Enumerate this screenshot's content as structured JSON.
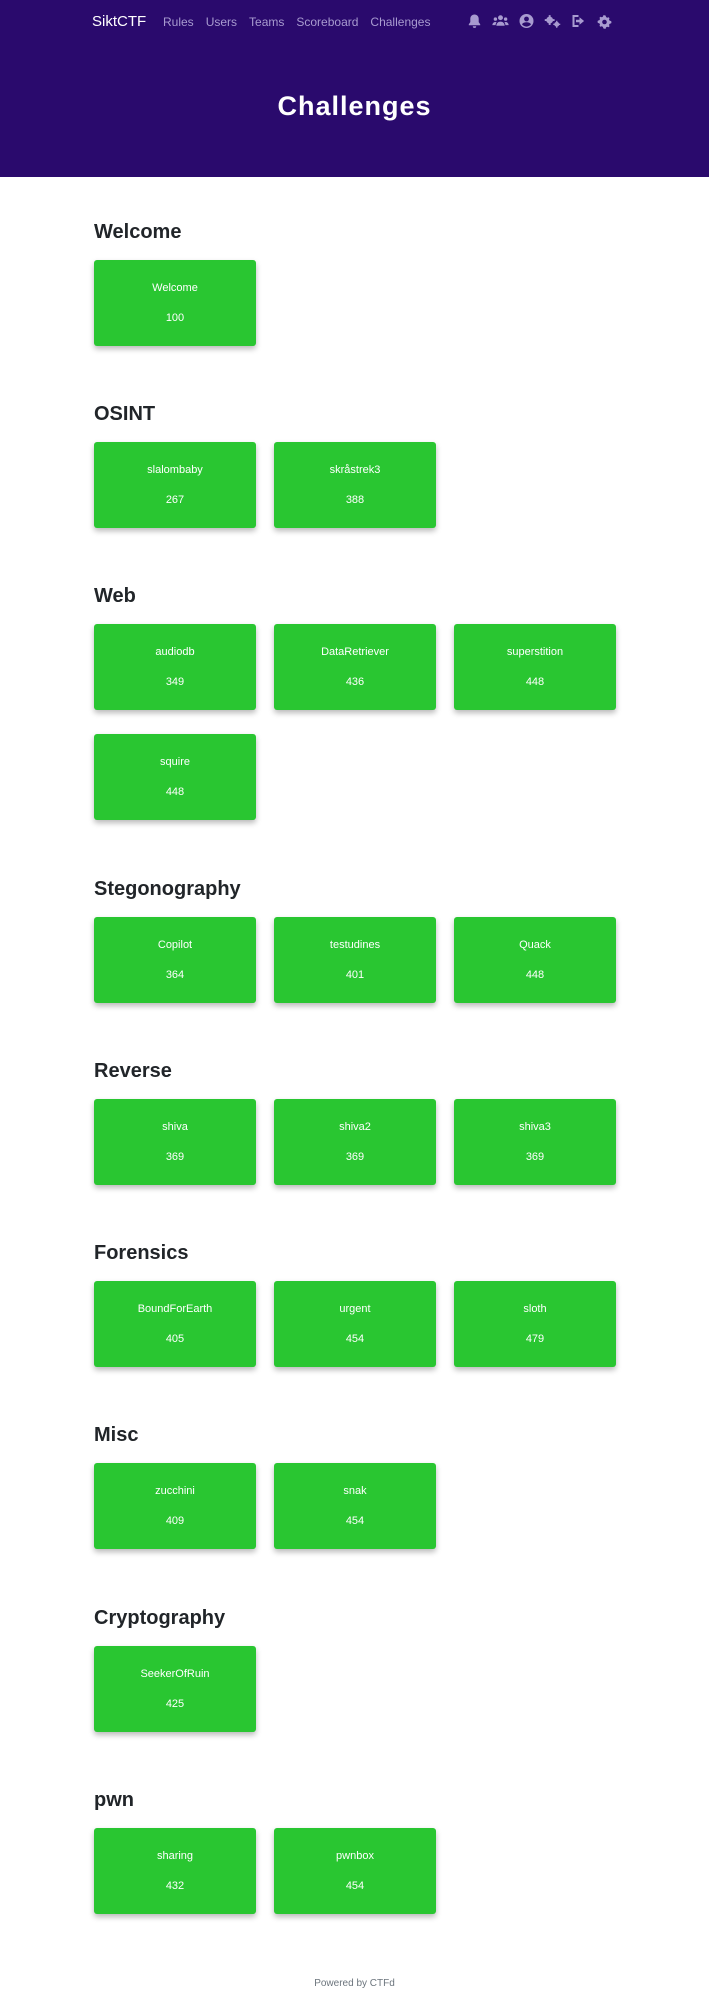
{
  "navbar": {
    "brand": "SiktCTF",
    "links": [
      {
        "label": "Rules"
      },
      {
        "label": "Users"
      },
      {
        "label": "Teams"
      },
      {
        "label": "Scoreboard"
      },
      {
        "label": "Challenges"
      }
    ],
    "icons": [
      "bell-icon",
      "users-icon",
      "user-circle-icon",
      "cogs-icon",
      "logout-icon",
      "gear-icon"
    ]
  },
  "header": {
    "title": "Challenges"
  },
  "colors": {
    "navbar_bg": "#2a0a6d",
    "card_bg": "#29c631",
    "nav_link": "#a89bd0"
  },
  "categories": [
    {
      "name": "Welcome",
      "challenges": [
        {
          "name": "Welcome",
          "value": "100"
        }
      ]
    },
    {
      "name": "OSINT",
      "challenges": [
        {
          "name": "slalombaby",
          "value": "267"
        },
        {
          "name": "skråstrek3",
          "value": "388"
        }
      ]
    },
    {
      "name": "Web",
      "challenges": [
        {
          "name": "audiodb",
          "value": "349"
        },
        {
          "name": "DataRetriever",
          "value": "436"
        },
        {
          "name": "superstition",
          "value": "448"
        },
        {
          "name": "squire",
          "value": "448"
        }
      ]
    },
    {
      "name": "Stegonography",
      "challenges": [
        {
          "name": "Copilot",
          "value": "364"
        },
        {
          "name": "testudines",
          "value": "401"
        },
        {
          "name": "Quack",
          "value": "448"
        }
      ]
    },
    {
      "name": "Reverse",
      "challenges": [
        {
          "name": "shiva",
          "value": "369"
        },
        {
          "name": "shiva2",
          "value": "369"
        },
        {
          "name": "shiva3",
          "value": "369"
        }
      ]
    },
    {
      "name": "Forensics",
      "challenges": [
        {
          "name": "BoundForEarth",
          "value": "405"
        },
        {
          "name": "urgent",
          "value": "454"
        },
        {
          "name": "sloth",
          "value": "479"
        }
      ]
    },
    {
      "name": "Misc",
      "challenges": [
        {
          "name": "zucchini",
          "value": "409"
        },
        {
          "name": "snak",
          "value": "454"
        }
      ]
    },
    {
      "name": "Cryptography",
      "challenges": [
        {
          "name": "SeekerOfRuin",
          "value": "425"
        }
      ]
    },
    {
      "name": "pwn",
      "challenges": [
        {
          "name": "sharing",
          "value": "432"
        },
        {
          "name": "pwnbox",
          "value": "454"
        }
      ]
    }
  ],
  "footer": {
    "text": "Powered by CTFd"
  }
}
